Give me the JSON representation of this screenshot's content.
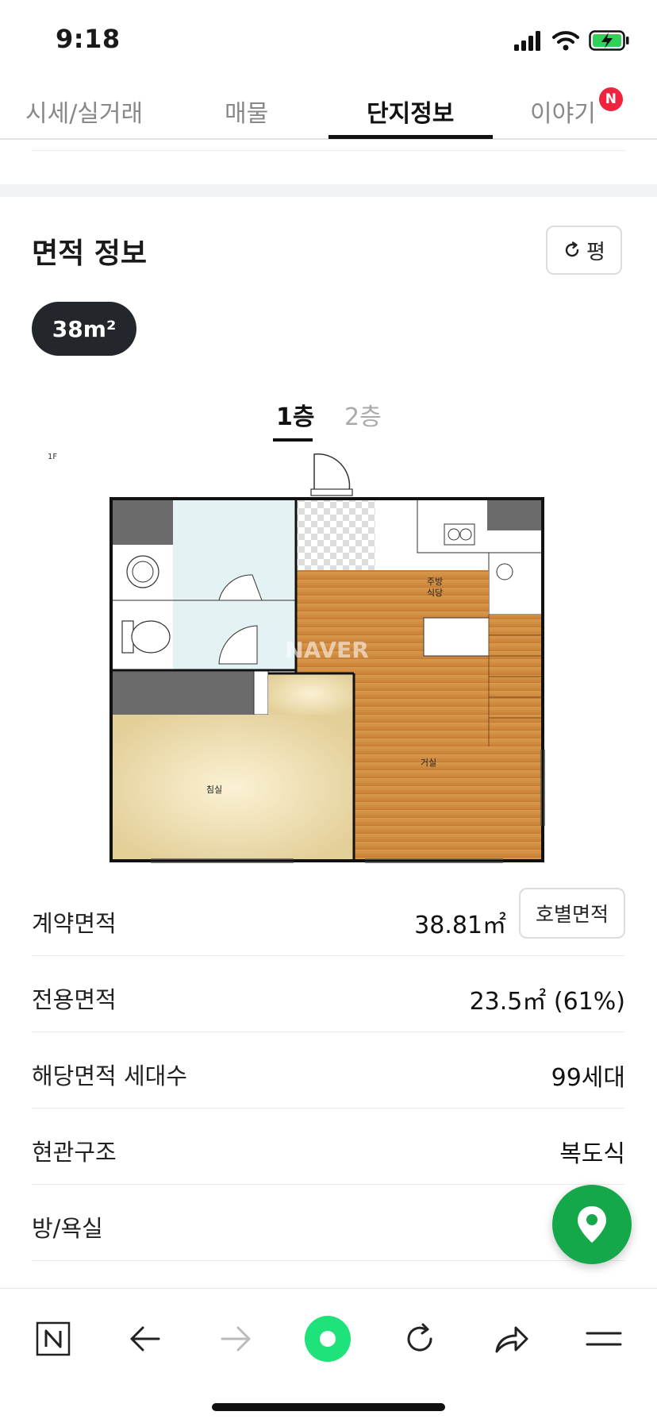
{
  "status_bar": {
    "time": "9:18"
  },
  "tabs": [
    {
      "label": "시세/실거래"
    },
    {
      "label": "매물"
    },
    {
      "label": "단지정보"
    },
    {
      "label": "이야기"
    }
  ],
  "tab_badge": "N",
  "section": {
    "title": "면적 정보",
    "unit_toggle_label": "평",
    "area_chip": "38m²"
  },
  "floor_tabs": [
    {
      "label": "1층"
    },
    {
      "label": "2층"
    }
  ],
  "floorplan": {
    "corner_label": "1F",
    "watermark": "NAVER",
    "rooms": {
      "kitchen_line1": "주방",
      "kitchen_line2": "식당",
      "living": "거실",
      "bedroom": "침실"
    }
  },
  "info_rows": [
    {
      "label": "계약면적",
      "value": "38.81㎡",
      "button": "호별면적"
    },
    {
      "label": "전용면적",
      "value": "23.5㎡ (61%)"
    },
    {
      "label": "해당면적 세대수",
      "value": "99세대"
    },
    {
      "label": "현관구조",
      "value": "복도식"
    },
    {
      "label": "방/욕실",
      "value": ""
    }
  ],
  "colors": {
    "accent_green": "#14a84a",
    "badge_red": "#f0233e",
    "chip_dark": "#23262b",
    "battery_green": "#2fd158"
  }
}
